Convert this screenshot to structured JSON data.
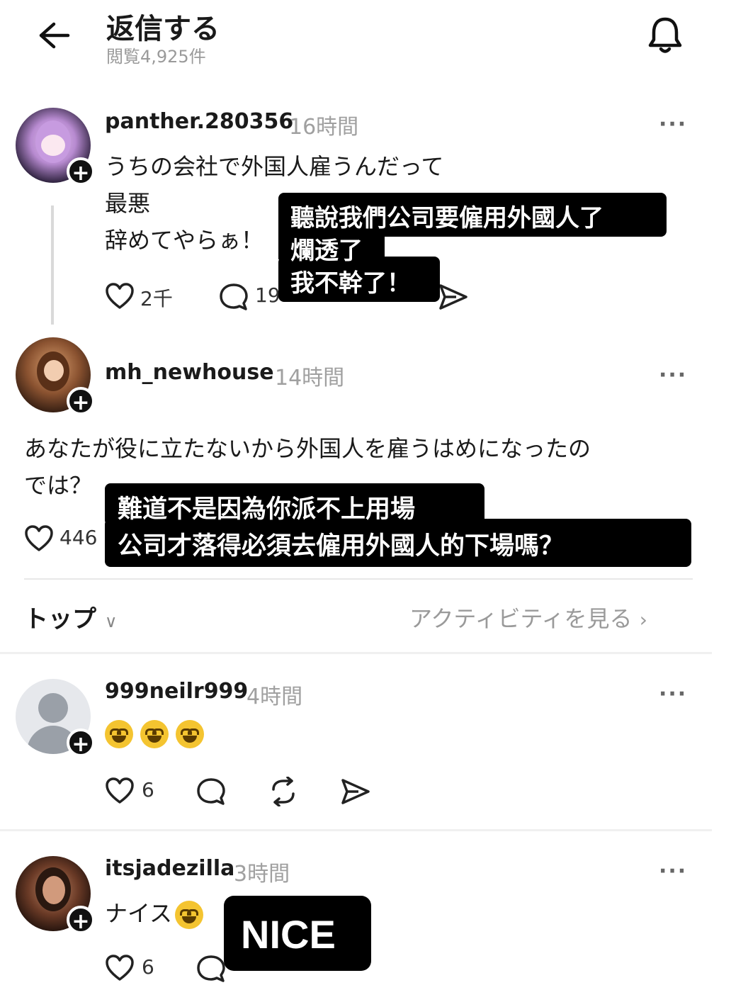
{
  "header": {
    "title": "返信する",
    "views": "閲覧4,925件"
  },
  "posts": [
    {
      "username": "panther.280356",
      "time": "16時間",
      "text_lines": [
        "うちの会社で外国人雇うんだって",
        "最悪",
        "辞めてやらぁ！"
      ],
      "likes": "2千",
      "comments": "19"
    },
    {
      "username": "mh_newhouse",
      "time": "14時間",
      "text_lines": [
        "あなたが役に立たないから外国人を雇うはめになったの",
        "では？"
      ],
      "likes": "446"
    }
  ],
  "sort": {
    "label": "トップ",
    "activity_link": "アクティビティを見る"
  },
  "replies": [
    {
      "username": "999neilr999",
      "time": "4時間",
      "likes": "6"
    },
    {
      "username": "itsjadezilla",
      "time": "3時間",
      "text": "ナイス",
      "likes": "6"
    }
  ],
  "overlays": {
    "o1_lines": [
      "聽說我們公司要僱用外國人了",
      "爛透了",
      "我不幹了！"
    ],
    "o2_lines": [
      "難道不是因為你派不上用場",
      "公司才落得必須去僱用外國人的下場嗎？"
    ],
    "o3": "NICE"
  },
  "icons": {
    "back": "arrow-left-icon",
    "bell": "bell-icon",
    "heart": "heart-icon",
    "comment": "comment-icon",
    "repost": "repost-icon",
    "share": "send-icon",
    "more": "more-icon"
  }
}
